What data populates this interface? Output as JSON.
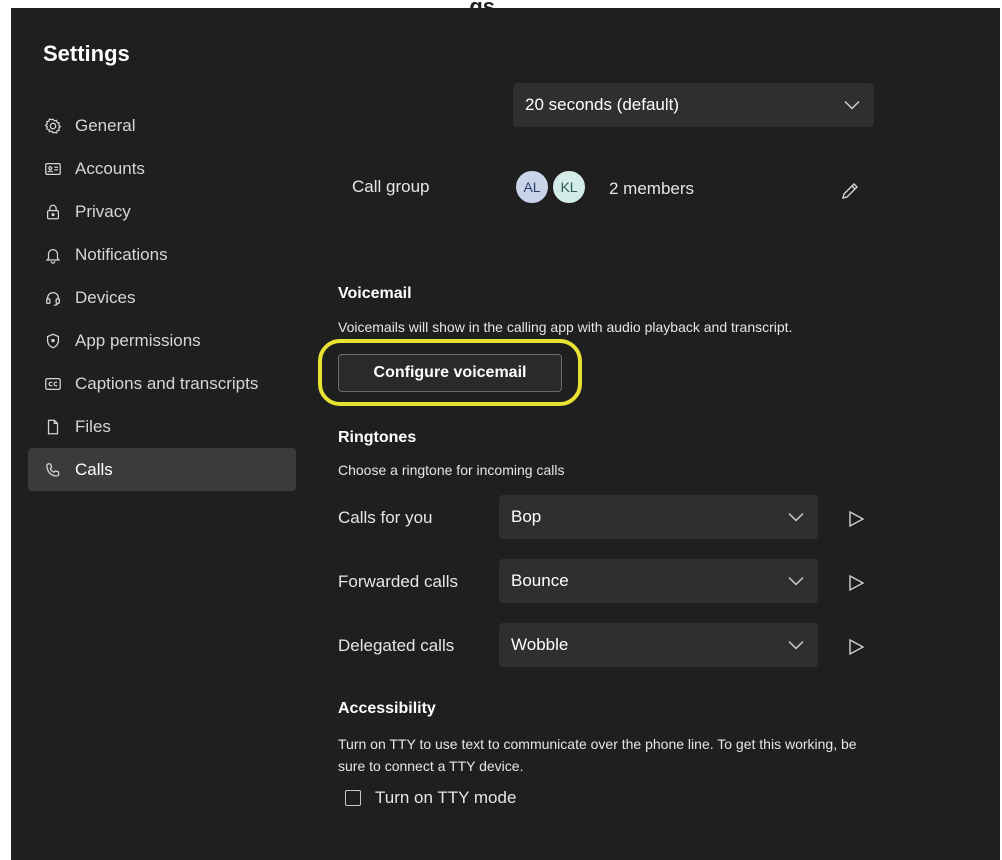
{
  "window_partial_title": "...gs",
  "settings_title": "Settings",
  "nav": [
    {
      "label": "General",
      "icon": "gear-icon"
    },
    {
      "label": "Accounts",
      "icon": "id-card-icon"
    },
    {
      "label": "Privacy",
      "icon": "lock-icon"
    },
    {
      "label": "Notifications",
      "icon": "bell-icon"
    },
    {
      "label": "Devices",
      "icon": "headset-icon"
    },
    {
      "label": "App permissions",
      "icon": "shield-icon"
    },
    {
      "label": "Captions and transcripts",
      "icon": "captions-icon"
    },
    {
      "label": "Files",
      "icon": "file-icon"
    },
    {
      "label": "Calls",
      "icon": "phone-icon",
      "active": true
    }
  ],
  "timeout_dropdown": {
    "value": "20 seconds (default)"
  },
  "call_group": {
    "label": "Call group",
    "avatars": [
      "AL",
      "KL"
    ],
    "members_text": "2 members"
  },
  "voicemail": {
    "title": "Voicemail",
    "description": "Voicemails will show in the calling app with audio playback and transcript.",
    "button": "Configure voicemail",
    "highlight_color": "#e8e233"
  },
  "ringtones": {
    "title": "Ringtones",
    "description": "Choose a ringtone for incoming calls",
    "rows": [
      {
        "label": "Calls for you",
        "value": "Bop"
      },
      {
        "label": "Forwarded calls",
        "value": "Bounce"
      },
      {
        "label": "Delegated calls",
        "value": "Wobble"
      }
    ]
  },
  "accessibility": {
    "title": "Accessibility",
    "description": "Turn on TTY to use text to communicate over the phone line. To get this working, be sure to connect a TTY device.",
    "checkbox_label": "Turn on TTY mode",
    "checked": false
  },
  "colors": {
    "background": "#1f1f1f",
    "active_nav": "#3b3b3b",
    "dropdown": "#2f2f2f",
    "text": "#ffffff"
  }
}
